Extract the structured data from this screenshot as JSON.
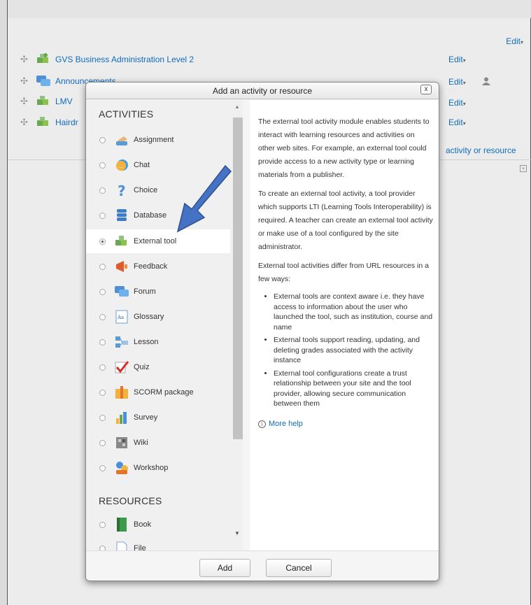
{
  "page": {
    "edit_top_label": "Edit",
    "rows": [
      {
        "label": "GVS Business Administration Level 2",
        "edit": "Edit"
      },
      {
        "label": "Announcements",
        "edit": "Edit"
      },
      {
        "label": "LMV",
        "edit": "Edit"
      },
      {
        "label": "Hairdr",
        "edit": "Edit"
      }
    ],
    "add_activity_link": "activity or resource"
  },
  "modal": {
    "title": "Add an activity or resource",
    "close": "x",
    "activities_heading": "ACTIVITIES",
    "resources_heading": "RESOURCES",
    "activities": [
      {
        "label": "Assignment",
        "icon": "assignment-icon"
      },
      {
        "label": "Chat",
        "icon": "chat-icon"
      },
      {
        "label": "Choice",
        "icon": "choice-icon"
      },
      {
        "label": "Database",
        "icon": "database-icon"
      },
      {
        "label": "External tool",
        "icon": "external-tool-icon",
        "selected": true
      },
      {
        "label": "Feedback",
        "icon": "feedback-icon"
      },
      {
        "label": "Forum",
        "icon": "forum-icon"
      },
      {
        "label": "Glossary",
        "icon": "glossary-icon"
      },
      {
        "label": "Lesson",
        "icon": "lesson-icon"
      },
      {
        "label": "Quiz",
        "icon": "quiz-icon"
      },
      {
        "label": "SCORM package",
        "icon": "scorm-icon"
      },
      {
        "label": "Survey",
        "icon": "survey-icon"
      },
      {
        "label": "Wiki",
        "icon": "wiki-icon"
      },
      {
        "label": "Workshop",
        "icon": "workshop-icon"
      }
    ],
    "resources": [
      {
        "label": "Book",
        "icon": "book-icon"
      },
      {
        "label": "File",
        "icon": "file-icon"
      }
    ],
    "help": {
      "p1": "The external tool activity module enables students to interact with learning resources and activities on other web sites. For example, an external tool could provide access to a new activity type or learning materials from a publisher.",
      "p2": "To create an external tool activity, a tool provider which supports LTI (Learning Tools Interoperability) is required. A teacher can create an external tool activity or make use of a tool configured by the site administrator.",
      "p3": "External tool activities differ from URL resources in a few ways:",
      "bullets": [
        "External tools are context aware i.e. they have access to information about the user who launched the tool, such as institution, course and name",
        "External tools support reading, updating, and deleting grades associated with the activity instance",
        "External tool configurations create a trust relationship between your site and the tool provider, allowing secure communication between them"
      ],
      "more_help": "More help"
    },
    "add_button": "Add",
    "cancel_button": "Cancel"
  },
  "colors": {
    "link": "#0f6cbf",
    "arrow": "#4472c4"
  }
}
